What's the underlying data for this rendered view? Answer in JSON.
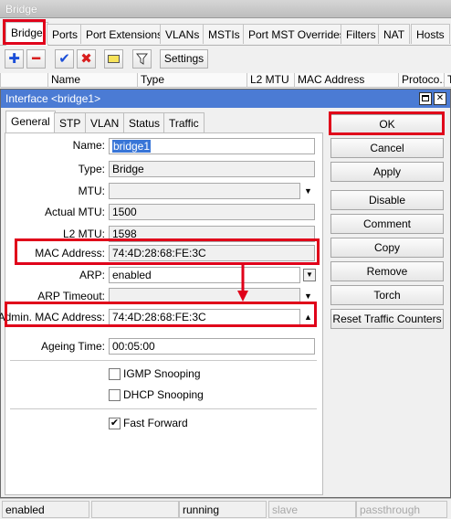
{
  "window": {
    "title": "Bridge"
  },
  "tabs": [
    "Bridge",
    "Ports",
    "Port Extensions",
    "VLANs",
    "MSTIs",
    "Port MST Overrides",
    "Filters",
    "NAT",
    "Hosts"
  ],
  "toolbar": {
    "add": "✚",
    "remove": "━",
    "enable": "✔",
    "disable": "✖",
    "comment": "▭",
    "filter": "⏷",
    "settings_label": "Settings"
  },
  "columns": [
    "Name",
    "Type",
    "L2 MTU",
    "MAC Address",
    "Protoco...",
    "T"
  ],
  "dialog": {
    "title": "Interface <bridge1>",
    "tabs": [
      "General",
      "STP",
      "VLAN",
      "Status",
      "Traffic"
    ],
    "fields": {
      "name_label": "Name:",
      "name_value": "bridge1",
      "type_label": "Type:",
      "type_value": "Bridge",
      "mtu_label": "MTU:",
      "mtu_value": "",
      "actual_mtu_label": "Actual MTU:",
      "actual_mtu_value": "1500",
      "l2mtu_label": "L2 MTU:",
      "l2mtu_value": "1598",
      "mac_label": "MAC Address:",
      "mac_value": "74:4D:28:68:FE:3C",
      "arp_label": "ARP:",
      "arp_value": "enabled",
      "arp_timeout_label": "ARP Timeout:",
      "arp_timeout_value": "",
      "admin_mac_label": "Admin. MAC Address:",
      "admin_mac_value": "74:4D:28:68:FE:3C",
      "ageing_label": "Ageing Time:",
      "ageing_value": "00:05:00"
    },
    "checkboxes": [
      {
        "label": "IGMP Snooping",
        "checked": false
      },
      {
        "label": "DHCP Snooping",
        "checked": false
      },
      {
        "label": "Fast Forward",
        "checked": true
      }
    ],
    "buttons": [
      "OK",
      "Cancel",
      "Apply",
      "Disable",
      "Comment",
      "Copy",
      "Remove",
      "Torch",
      "Reset Traffic Counters"
    ]
  },
  "status": [
    "enabled",
    "",
    "running",
    "slave",
    "passthrough"
  ],
  "colors": {
    "highlight": "#e0001a",
    "dialog_title": "#4b7bd4",
    "selection": "#3875d7"
  }
}
